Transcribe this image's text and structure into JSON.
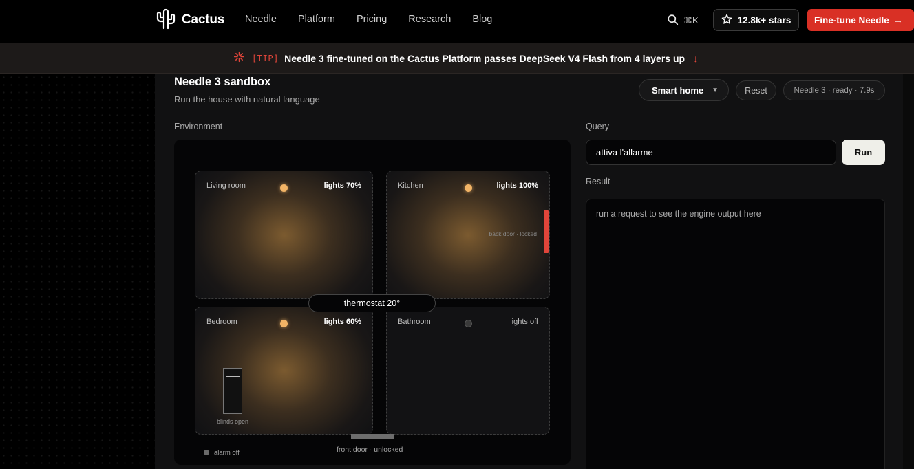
{
  "nav": {
    "brand": "Cactus",
    "links": [
      "Needle",
      "Platform",
      "Pricing",
      "Research",
      "Blog"
    ],
    "search_shortcut": "⌘K",
    "stars_label": "12.8k+ stars",
    "cta_label": "Fine-tune Needle",
    "cta_color": "#d93025"
  },
  "tip": {
    "tag": "[TIP]",
    "text": "Needle 3 fine-tuned on the Cactus Platform passes DeepSeek V4 Flash from 4 layers up"
  },
  "sandbox": {
    "title": "Needle 3 sandbox",
    "subtitle": "Run the house with natural language",
    "mode_selected": "Smart home",
    "reset_label": "Reset",
    "status": "Needle 3 · ready · 7.9s"
  },
  "environment": {
    "label": "Environment",
    "rooms": [
      {
        "name": "Living room",
        "lights": "lights 70%",
        "on": true
      },
      {
        "name": "Kitchen",
        "lights": "lights 100%",
        "on": true
      },
      {
        "name": "Bedroom",
        "lights": "lights 60%",
        "on": true
      },
      {
        "name": "Bathroom",
        "lights": "lights off",
        "on": false
      }
    ],
    "back_door": "back door · locked",
    "blinds": "blinds open",
    "thermostat": "thermostat 20°",
    "front_door": "front door · unlocked",
    "alarm": "alarm off",
    "accent_color": "#e0453a",
    "light_color": "#f2b466"
  },
  "query": {
    "label": "Query",
    "value": "attiva l'allarme",
    "run_label": "Run"
  },
  "result": {
    "label": "Result",
    "placeholder": "run a request to see the engine output here"
  }
}
